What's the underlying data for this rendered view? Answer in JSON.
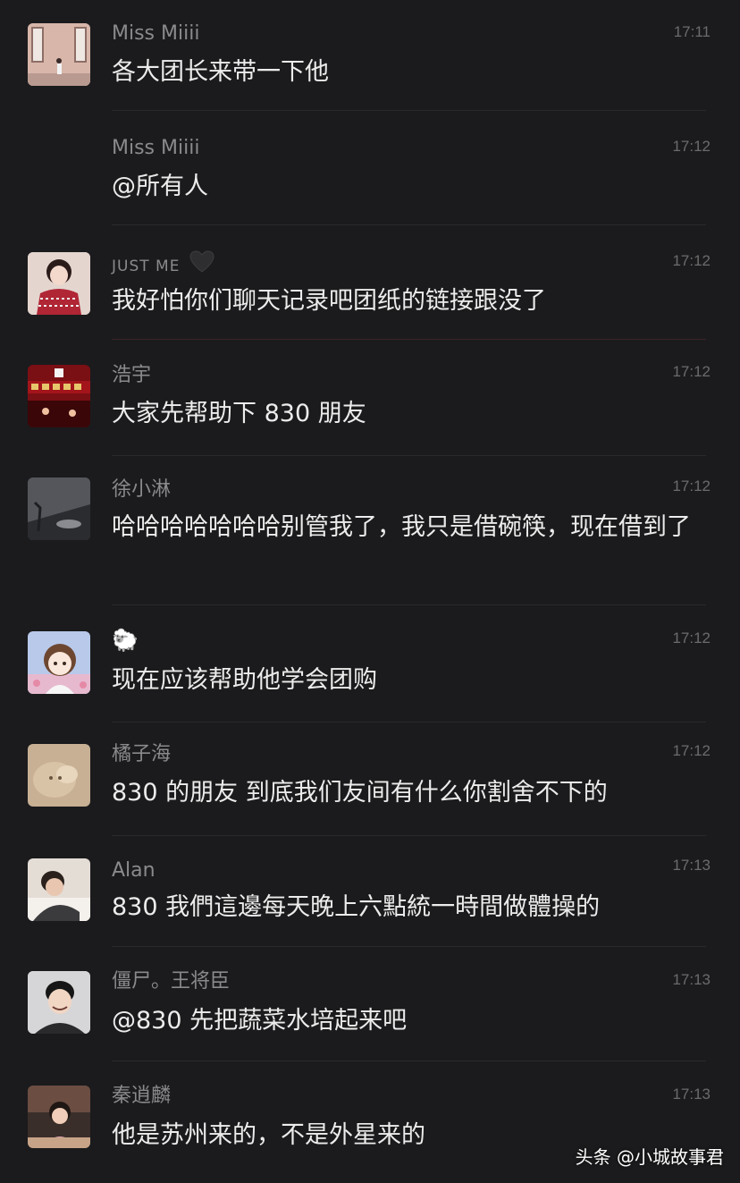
{
  "messages": [
    {
      "name": "Miss Miiii",
      "time": "17:11",
      "text": "各大团长来带一下他"
    },
    {
      "name": "Miss Miiii",
      "time": "17:12",
      "text": "@所有人"
    },
    {
      "name": "JUST ME",
      "time": "17:12",
      "text": "我好怕你们聊天记录吧团纸的链接跟没了"
    },
    {
      "name": "浩宇",
      "time": "17:12",
      "text": "大家先帮助下 830 朋友"
    },
    {
      "name": "徐小淋",
      "time": "17:12",
      "text": "哈哈哈哈哈哈哈别管我了，我只是借碗筷，现在借到了"
    },
    {
      "name": "🐑",
      "time": "17:12",
      "text": "现在应该帮助他学会团购"
    },
    {
      "name": "橘子海",
      "time": "17:12",
      "text": "830 的朋友 到底我们友间有什么你割舍不下的"
    },
    {
      "name": "Alan",
      "time": "17:13",
      "text": "830 我們這邊每天晚上六點統一時間做體操的"
    },
    {
      "name": "僵尸。王将臣",
      "time": "17:13",
      "text": "@830 先把蔬菜水培起来吧"
    },
    {
      "name": "秦逍麟",
      "time": "17:13",
      "text": "他是苏州来的，不是外星来的"
    }
  ],
  "watermark": "头条 @小城故事君",
  "colors": {
    "background": "#1b1b1d",
    "name": "#8a8a8c",
    "time": "#6b6b6d",
    "text": "#ececec",
    "divider": "#2a2a2c"
  },
  "icons": {
    "just_me_suffix": "black-heart-icon"
  }
}
